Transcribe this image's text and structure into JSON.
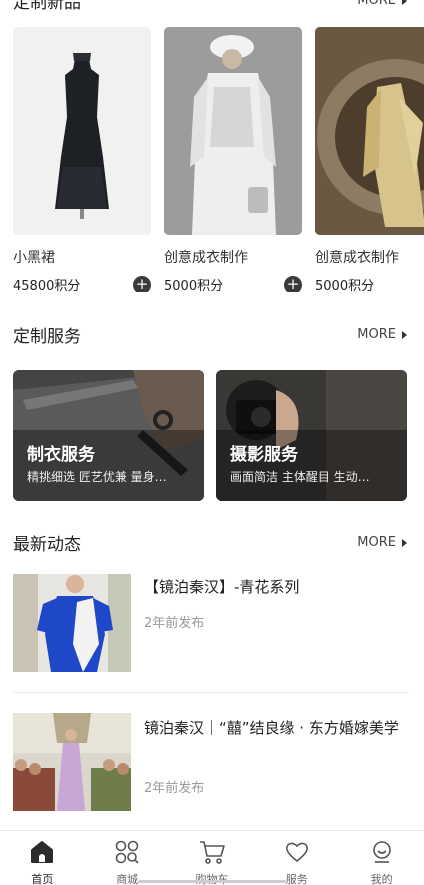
{
  "products_section": {
    "title": "定制新品",
    "more": "MORE"
  },
  "products": [
    {
      "name": "小黑裙",
      "price": "45800积分"
    },
    {
      "name": "创意成衣制作",
      "price": "5000积分"
    },
    {
      "name": "创意成衣制作",
      "price": "5000积分"
    }
  ],
  "services_section": {
    "title": "定制服务",
    "more": "MORE"
  },
  "services": [
    {
      "title": "制衣服务",
      "subtitle": "精挑细选 匠艺优兼 量身…"
    },
    {
      "title": "摄影服务",
      "subtitle": "画面简洁 主体醒目 生动…"
    }
  ],
  "news_section": {
    "title": "最新动态",
    "more": "MORE"
  },
  "news": [
    {
      "title": "【镜泊秦汉】-青花系列",
      "time": "2年前发布"
    },
    {
      "title": "镜泊秦汉｜“囍”结良缘 · 东方婚嫁美学",
      "time": "2年前发布"
    }
  ],
  "tabs": [
    {
      "label": "首页",
      "icon": "home-icon"
    },
    {
      "label": "商城",
      "icon": "grid-search-icon"
    },
    {
      "label": "购物车",
      "icon": "cart-icon"
    },
    {
      "label": "服务",
      "icon": "heart-icon"
    },
    {
      "label": "我的",
      "icon": "user-icon"
    }
  ],
  "colors": {
    "accent": "#222222",
    "muted": "#999999"
  }
}
